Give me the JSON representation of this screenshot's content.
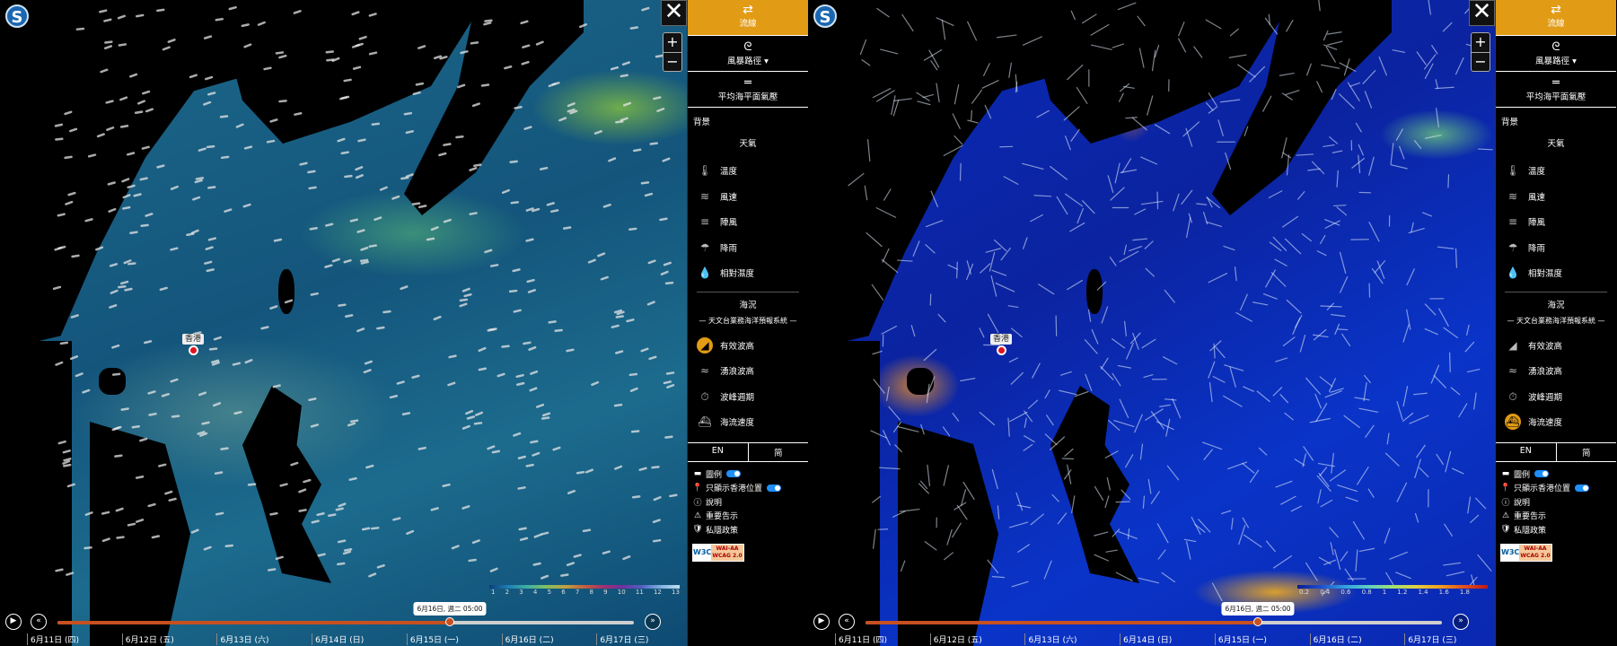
{
  "app": {
    "logo_glyph": "S"
  },
  "map": {
    "hk_label": "香港",
    "close_glyph": "✕",
    "zoom_in": "+",
    "zoom_out": "−"
  },
  "left_colorbar": {
    "ticks": [
      "1",
      "2",
      "3",
      "4",
      "5",
      "6",
      "7",
      "8",
      "9",
      "10",
      "11",
      "12",
      "13"
    ]
  },
  "right_colorbar": {
    "ticks": [
      "0.2",
      "0.4",
      "0.6",
      "0.8",
      "1",
      "1.2",
      "1.4",
      "1.6",
      "1.8"
    ]
  },
  "timeline": {
    "play_glyph": "▶",
    "rewind_glyph": "«",
    "forward_glyph": "»",
    "current": "6月16日, 週二 05:00",
    "progress": 0.68,
    "days": [
      "6月11日 (四)",
      "6月12日 (五)",
      "6月13日 (六)",
      "6月14日 (日)",
      "6月15日 (一)",
      "6月16日 (二)",
      "6月17日 (三)"
    ]
  },
  "panel": {
    "streamline_label": "流線",
    "streamline_icon": "⇄",
    "typhoon_label": "風暴路徑",
    "typhoon_icon": "ᘓ",
    "mslp_label": "平均海平面氣壓",
    "mslp_icon": "═",
    "background_label": "背景",
    "weather_head": "天氣",
    "weather_items": [
      {
        "label": "溫度",
        "icon": "🌡"
      },
      {
        "label": "風速",
        "icon": "≋"
      },
      {
        "label": "陣風",
        "icon": "≡"
      },
      {
        "label": "降雨",
        "icon": "☂"
      },
      {
        "label": "相對濕度",
        "icon": "💧"
      }
    ],
    "ocean_head": "海況",
    "ocean_source": "— 天文台業務海洋預報系統 —",
    "ocean_items": [
      {
        "label": "有效波高",
        "icon": "◢"
      },
      {
        "label": "湧浪波高",
        "icon": "≈"
      },
      {
        "label": "波峰週期",
        "icon": "⏱"
      },
      {
        "label": "海流速度",
        "icon": "⛴"
      }
    ],
    "lang_en": "EN",
    "lang_sc": "简",
    "options": [
      {
        "label": "圖例",
        "icon": "▬",
        "toggle": true
      },
      {
        "label": "只顯示香港位置",
        "icon": "📍",
        "toggle": true
      },
      {
        "label": "說明",
        "icon": "ⓘ",
        "toggle": false
      },
      {
        "label": "重要告示",
        "icon": "⚠",
        "toggle": false
      },
      {
        "label": "私隱政策",
        "icon": "🛡",
        "toggle": false
      }
    ],
    "w3c_logo": "W3C",
    "w3c_badge_1": "WAI-AA",
    "w3c_badge_2": "WCAG 2.0"
  },
  "colors": {
    "accent": "#e29b14",
    "timeline_fill": "#c85020",
    "toggle_on": "#1e8fff",
    "left_ocean": "#14557c",
    "right_ocean": "#0a2bb8"
  }
}
